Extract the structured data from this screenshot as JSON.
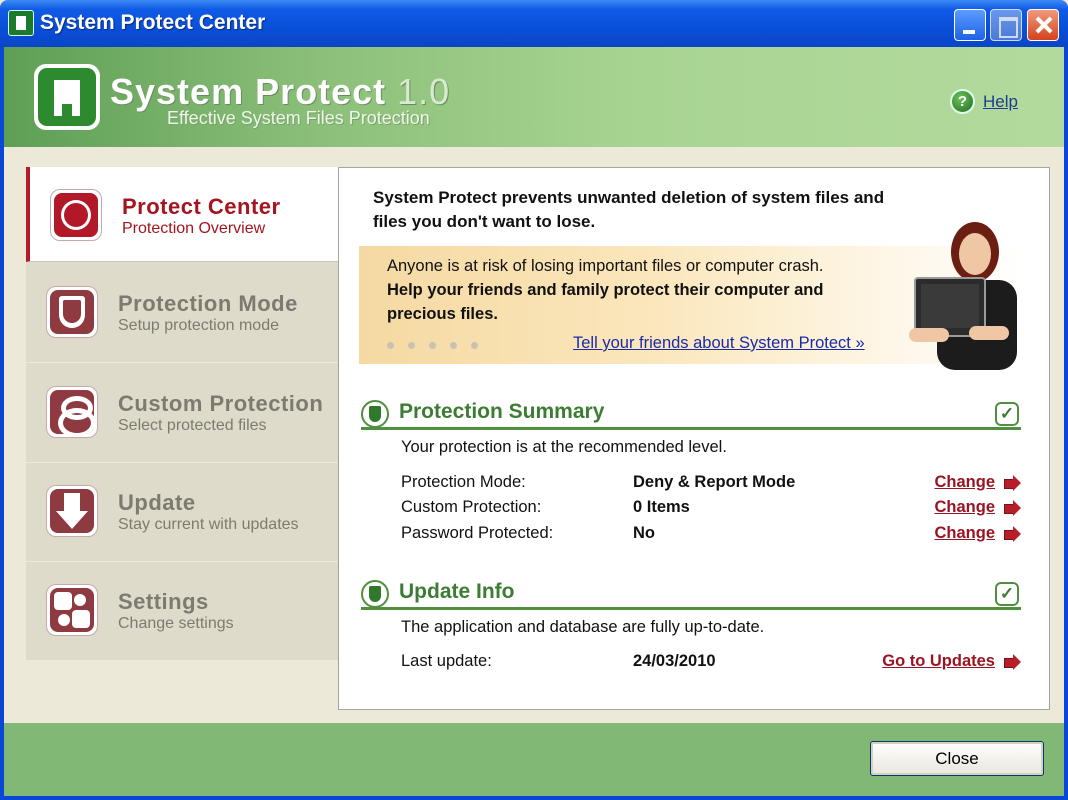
{
  "window": {
    "title": "System Protect Center"
  },
  "header": {
    "brand": "System Protect",
    "version": "1.0",
    "tagline": "Effective System Files Protection",
    "help_label": "Help"
  },
  "sidebar": {
    "items": [
      {
        "title": "Protect Center",
        "subtitle": "Protection Overview",
        "icon": "protect-center-icon",
        "active": true
      },
      {
        "title": "Protection Mode",
        "subtitle": "Setup protection mode",
        "icon": "shield-icon",
        "active": false
      },
      {
        "title": "Custom Protection",
        "subtitle": "Select protected files",
        "icon": "custom-protection-icon",
        "active": false
      },
      {
        "title": "Update",
        "subtitle": "Stay current with updates",
        "icon": "download-icon",
        "active": false
      },
      {
        "title": "Settings",
        "subtitle": "Change settings",
        "icon": "puzzle-icon",
        "active": false
      }
    ]
  },
  "main": {
    "intro": "System Protect prevents unwanted deletion of system files and files you don't want to lose.",
    "promo": {
      "line1": "Anyone is at risk of losing important files or computer crash.",
      "line2": "Help your friends and family protect their computer and precious files.",
      "link": "Tell your friends about System Protect »"
    },
    "summary": {
      "title": "Protection Summary",
      "status": "Your protection is at the recommended level.",
      "rows": [
        {
          "label": "Protection Mode:",
          "value": "Deny & Report Mode",
          "action": "Change"
        },
        {
          "label": "Custom Protection:",
          "value": "0 Items",
          "action": "Change"
        },
        {
          "label": "Password Protected:",
          "value": "No",
          "action": "Change"
        }
      ]
    },
    "update": {
      "title": "Update Info",
      "status": "The application and database are fully up-to-date.",
      "last_update_label": "Last update:",
      "last_update_value": "24/03/2010",
      "action": "Go to Updates"
    }
  },
  "footer": {
    "close_label": "Close"
  },
  "colors": {
    "title_bar": "#0a4fd8",
    "banner_green": "#8cc07a",
    "accent_red": "#a5141f",
    "section_green": "#3d7d33"
  }
}
